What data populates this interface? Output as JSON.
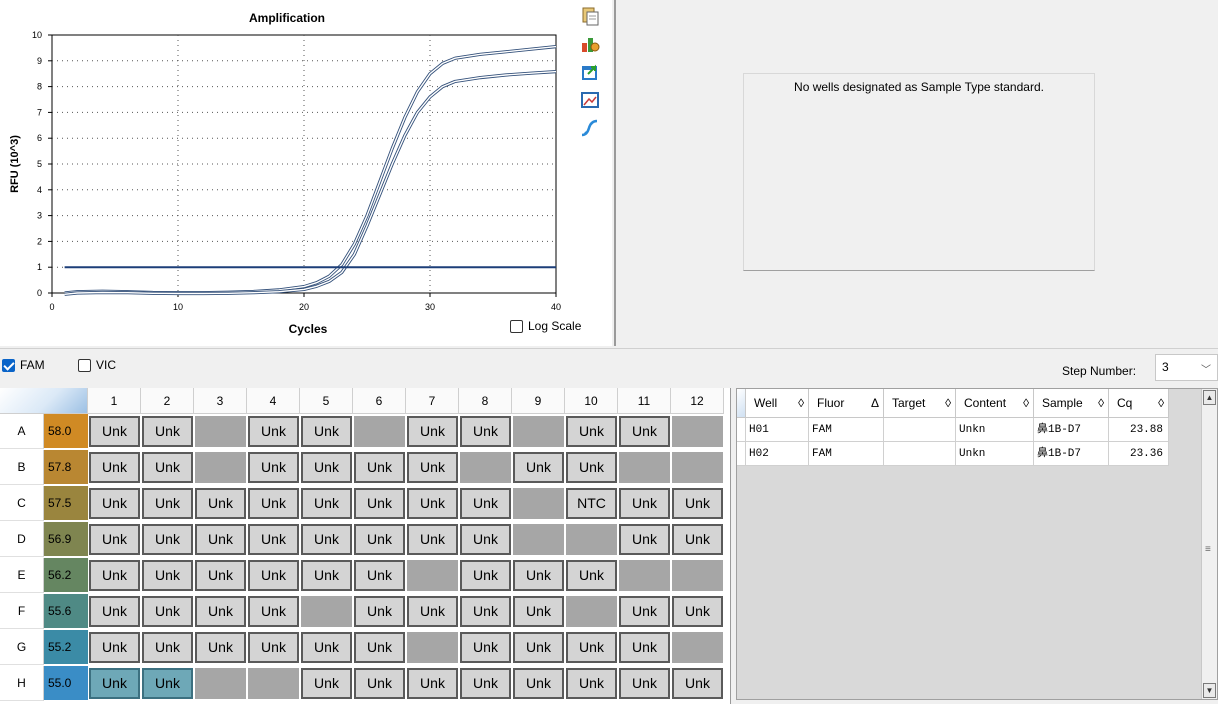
{
  "chart": {
    "chart_data": {
      "type": "line",
      "title": "Amplification",
      "xlabel": "Cycles",
      "ylabel": "RFU (10^3)",
      "xlim": [
        0,
        40
      ],
      "ylim": [
        0,
        10
      ],
      "x_ticks": [
        0,
        10,
        20,
        30,
        40
      ],
      "y_ticks": [
        0,
        1,
        2,
        3,
        4,
        5,
        6,
        7,
        8,
        9,
        10
      ],
      "grid": "dotted",
      "threshold": 1.0,
      "series": [
        {
          "color": "#5b84b4",
          "x": [
            1,
            2,
            4,
            6,
            8,
            10,
            12,
            14,
            16,
            18,
            20,
            21,
            22,
            23,
            24,
            25,
            26,
            27,
            28,
            29,
            30,
            31,
            32,
            34,
            36,
            38,
            40
          ],
          "y": [
            0.0,
            0.05,
            0.07,
            0.05,
            0.02,
            0.01,
            0.01,
            0.03,
            0.06,
            0.12,
            0.25,
            0.4,
            0.65,
            1.1,
            1.9,
            3.0,
            4.3,
            5.6,
            6.8,
            7.8,
            8.5,
            8.9,
            9.1,
            9.25,
            9.35,
            9.45,
            9.55
          ]
        },
        {
          "color": "#5b84b4",
          "x": [
            1,
            2,
            4,
            6,
            8,
            10,
            12,
            14,
            16,
            18,
            20,
            21,
            22,
            23,
            24,
            25,
            26,
            27,
            28,
            29,
            30,
            31,
            32,
            34,
            36,
            38,
            40
          ],
          "y": [
            -0.05,
            0.0,
            0.02,
            0.01,
            -0.01,
            -0.02,
            -0.02,
            -0.01,
            0.01,
            0.05,
            0.14,
            0.26,
            0.45,
            0.8,
            1.5,
            2.6,
            3.8,
            5.0,
            6.1,
            7.0,
            7.6,
            8.0,
            8.2,
            8.35,
            8.45,
            8.52,
            8.58
          ]
        }
      ]
    },
    "log_scale_label": "Log Scale",
    "log_scale_checked": false
  },
  "standard_curve": {
    "message": "No wells designated as Sample Type standard."
  },
  "fluors": [
    {
      "label": "FAM",
      "checked": true
    },
    {
      "label": "VIC",
      "checked": false
    }
  ],
  "step": {
    "label": "Step Number:",
    "value": "3"
  },
  "plate": {
    "columns": [
      "1",
      "2",
      "3",
      "4",
      "5",
      "6",
      "7",
      "8",
      "9",
      "10",
      "11",
      "12"
    ],
    "rows": [
      {
        "label": "A",
        "temp": "58.0",
        "color": "#d08a24",
        "wells": [
          "Unk",
          "Unk",
          "",
          "Unk",
          "Unk",
          "",
          "Unk",
          "Unk",
          "",
          "Unk",
          "Unk",
          ""
        ]
      },
      {
        "label": "B",
        "temp": "57.8",
        "color": "#b98732",
        "wells": [
          "Unk",
          "Unk",
          "",
          "Unk",
          "Unk",
          "Unk",
          "Unk",
          "",
          "Unk",
          "Unk",
          "",
          ""
        ]
      },
      {
        "label": "C",
        "temp": "57.5",
        "color": "#9a853e",
        "wells": [
          "Unk",
          "Unk",
          "Unk",
          "Unk",
          "Unk",
          "Unk",
          "Unk",
          "Unk",
          "",
          "NTC",
          "Unk",
          "Unk"
        ]
      },
      {
        "label": "D",
        "temp": "56.9",
        "color": "#7f8550",
        "wells": [
          "Unk",
          "Unk",
          "Unk",
          "Unk",
          "Unk",
          "Unk",
          "Unk",
          "Unk",
          "",
          "",
          "Unk",
          "Unk"
        ]
      },
      {
        "label": "E",
        "temp": "56.2",
        "color": "#658661",
        "wells": [
          "Unk",
          "Unk",
          "Unk",
          "Unk",
          "Unk",
          "Unk",
          "",
          "Unk",
          "Unk",
          "Unk",
          "",
          ""
        ]
      },
      {
        "label": "F",
        "temp": "55.6",
        "color": "#4f8a85",
        "wells": [
          "Unk",
          "Unk",
          "Unk",
          "Unk",
          "",
          "Unk",
          "Unk",
          "Unk",
          "Unk",
          "",
          "Unk",
          "Unk"
        ]
      },
      {
        "label": "G",
        "temp": "55.2",
        "color": "#3b8ba6",
        "wells": [
          "Unk",
          "Unk",
          "Unk",
          "Unk",
          "Unk",
          "Unk",
          "",
          "Unk",
          "Unk",
          "Unk",
          "Unk",
          ""
        ]
      },
      {
        "label": "H",
        "temp": "55.0",
        "color": "#3a8dc6",
        "wells": [
          "Unk",
          "Unk",
          "",
          "",
          "Unk",
          "Unk",
          "Unk",
          "Unk",
          "Unk",
          "Unk",
          "Unk",
          "Unk"
        ]
      }
    ],
    "selected_wells": [
      "H1",
      "H2"
    ]
  },
  "results": {
    "columns": [
      {
        "label": "Well",
        "sort": "◊"
      },
      {
        "label": "Fluor",
        "sort": "Δ"
      },
      {
        "label": "Target",
        "sort": "◊"
      },
      {
        "label": "Content",
        "sort": "◊"
      },
      {
        "label": "Sample",
        "sort": "◊"
      },
      {
        "label": "Cq",
        "sort": "◊"
      }
    ],
    "rows": [
      {
        "well": "H01",
        "fluor": "FAM",
        "target": "",
        "content": "Unkn",
        "sample": "鼻1B-D7",
        "cq": "23.88"
      },
      {
        "well": "H02",
        "fluor": "FAM",
        "target": "",
        "content": "Unkn",
        "sample": "鼻1B-D7",
        "cq": "23.36"
      }
    ]
  },
  "toolbar_icons": [
    "copy-icon",
    "chart-settings-icon",
    "export-icon",
    "zoom-image-icon",
    "curve-fit-icon"
  ]
}
